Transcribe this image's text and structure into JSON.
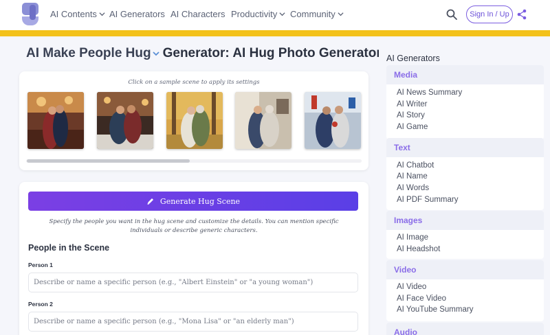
{
  "nav": {
    "items": [
      {
        "label": "AI Contents",
        "dropdown": true
      },
      {
        "label": "AI Generators",
        "dropdown": false
      },
      {
        "label": "AI Characters",
        "dropdown": false
      },
      {
        "label": "Productivity",
        "dropdown": true
      },
      {
        "label": "Community",
        "dropdown": true
      }
    ],
    "signin_label": "Sign In / Up",
    "icons": [
      "logo-icon",
      "search-icon",
      "share-icon"
    ],
    "accent_color": "#6a4fd8",
    "banner_color": "#f3c21b"
  },
  "page": {
    "title_part1": "AI Make People Hug",
    "title_part2": "Generator: AI Hug Photo Generator"
  },
  "samples": {
    "hint": "Click on a sample scene to apply its settings",
    "scenes": [
      "ballroom-hug",
      "dinner-hug",
      "park-hug",
      "home-hug",
      "street-hug"
    ]
  },
  "form": {
    "generate_label": "Generate Hug Scene",
    "description": "Specify the people you want in the hug scene and customize the details. You can mention specific individuals or describe generic characters.",
    "section_title": "People in the Scene",
    "person1_label": "Person 1",
    "person1_placeholder": "Describe or name a specific person (e.g., \"Albert Einstein\" or \"a young woman\")",
    "person2_label": "Person 2",
    "person2_placeholder": "Describe or name a specific person (e.g., \"Mona Lisa\" or \"an elderly man\")",
    "button_gradient": [
      "#7b3fe4",
      "#5a3fe6"
    ]
  },
  "sidebar": {
    "title": "AI Generators",
    "groups": [
      {
        "name": "Media",
        "links": [
          "AI News Summary",
          "AI Writer",
          "AI Story",
          "AI Game"
        ]
      },
      {
        "name": "Text",
        "links": [
          "AI Chatbot",
          "AI Name",
          "AI Words",
          "AI PDF Summary"
        ]
      },
      {
        "name": "Images",
        "links": [
          "AI Image",
          "AI Headshot"
        ]
      },
      {
        "name": "Video",
        "links": [
          "AI Video",
          "AI Face Video",
          "AI YouTube Summary"
        ]
      },
      {
        "name": "Audio",
        "links": []
      }
    ],
    "group_color": "#8a6de8"
  }
}
